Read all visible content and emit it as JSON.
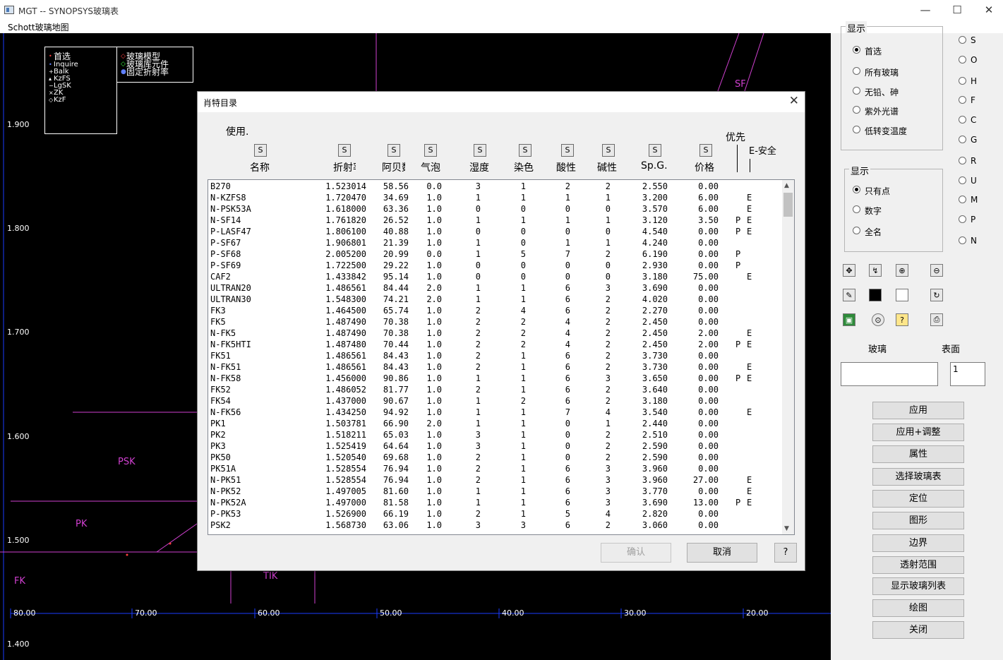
{
  "window": {
    "title": "MGT -- SYNOPSYS玻璃表",
    "minimize": "—",
    "maximize": "☐",
    "close": "✕"
  },
  "menu": {
    "item": "Schott玻璃地图"
  },
  "map": {
    "region_labels": [
      "SF",
      "PSK",
      "PK",
      "FK",
      "TIK"
    ],
    "y_ticks": [
      "1.900",
      "1.800",
      "1.700",
      "1.600",
      "1.500",
      "1.400"
    ],
    "x_ticks": [
      "80.00",
      "70.00",
      "60.00",
      "50.00",
      "40.00",
      "30.00",
      "20.00"
    ],
    "legend": [
      "首选",
      "Inquire",
      "Balk",
      "KzFS",
      "LgSK",
      "ZK",
      "KzF"
    ],
    "legend2": [
      "玻璃模型",
      "玻璃库元件",
      "固定折射率"
    ]
  },
  "dialog": {
    "title": "肖特目录",
    "close": "✕",
    "use_label": "使用.",
    "priority_label": "优先",
    "safe_label": "E-安全",
    "sort_btn": "S",
    "columns": [
      "名称",
      "折射率",
      "阿贝数",
      "气泡",
      "湿度",
      "染色",
      "酸性",
      "碱性",
      "Sp.G.",
      "价格"
    ],
    "rows": [
      [
        "B270",
        "1.523014",
        "58.56",
        "0.0",
        "3",
        "1",
        "2",
        "2",
        "2.550",
        "0.00",
        "",
        ""
      ],
      [
        "N-KZFS8",
        "1.720470",
        "34.69",
        "1.0",
        "1",
        "1",
        "1",
        "1",
        "3.200",
        "6.00",
        "",
        "E"
      ],
      [
        "N-PSK53A",
        "1.618000",
        "63.36",
        "1.0",
        "0",
        "0",
        "0",
        "0",
        "3.570",
        "6.00",
        "",
        "E"
      ],
      [
        "N-SF14",
        "1.761820",
        "26.52",
        "1.0",
        "1",
        "1",
        "1",
        "1",
        "3.120",
        "3.50",
        "P",
        "E"
      ],
      [
        "P-LASF47",
        "1.806100",
        "40.88",
        "1.0",
        "0",
        "0",
        "0",
        "0",
        "4.540",
        "0.00",
        "P",
        "E"
      ],
      [
        "P-SF67",
        "1.906801",
        "21.39",
        "1.0",
        "1",
        "0",
        "1",
        "1",
        "4.240",
        "0.00",
        "",
        ""
      ],
      [
        "P-SF68",
        "2.005200",
        "20.99",
        "0.0",
        "1",
        "5",
        "7",
        "2",
        "6.190",
        "0.00",
        "P",
        ""
      ],
      [
        "P-SF69",
        "1.722500",
        "29.22",
        "1.0",
        "0",
        "0",
        "0",
        "0",
        "2.930",
        "0.00",
        "P",
        ""
      ],
      [
        "CAF2",
        "1.433842",
        "95.14",
        "1.0",
        "0",
        "0",
        "0",
        "0",
        "3.180",
        "75.00",
        "",
        "E"
      ],
      [
        "ULTRAN20",
        "1.486561",
        "84.44",
        "2.0",
        "1",
        "1",
        "6",
        "3",
        "3.690",
        "0.00",
        "",
        ""
      ],
      [
        "ULTRAN30",
        "1.548300",
        "74.21",
        "2.0",
        "1",
        "1",
        "6",
        "2",
        "4.020",
        "0.00",
        "",
        ""
      ],
      [
        "FK3",
        "1.464500",
        "65.74",
        "1.0",
        "2",
        "4",
        "6",
        "2",
        "2.270",
        "0.00",
        "",
        ""
      ],
      [
        "FK5",
        "1.487490",
        "70.38",
        "1.0",
        "2",
        "2",
        "4",
        "2",
        "2.450",
        "0.00",
        "",
        ""
      ],
      [
        "N-FK5",
        "1.487490",
        "70.38",
        "1.0",
        "2",
        "2",
        "4",
        "2",
        "2.450",
        "2.00",
        "",
        "E"
      ],
      [
        "N-FK5HTI",
        "1.487480",
        "70.44",
        "1.0",
        "2",
        "2",
        "4",
        "2",
        "2.450",
        "2.00",
        "P",
        "E"
      ],
      [
        "FK51",
        "1.486561",
        "84.43",
        "1.0",
        "2",
        "1",
        "6",
        "2",
        "3.730",
        "0.00",
        "",
        ""
      ],
      [
        "N-FK51",
        "1.486561",
        "84.43",
        "1.0",
        "2",
        "1",
        "6",
        "2",
        "3.730",
        "0.00",
        "",
        "E"
      ],
      [
        "N-FK58",
        "1.456000",
        "90.86",
        "1.0",
        "1",
        "1",
        "6",
        "3",
        "3.650",
        "0.00",
        "P",
        "E"
      ],
      [
        "FK52",
        "1.486052",
        "81.77",
        "1.0",
        "2",
        "1",
        "6",
        "2",
        "3.640",
        "0.00",
        "",
        ""
      ],
      [
        "FK54",
        "1.437000",
        "90.67",
        "1.0",
        "1",
        "2",
        "6",
        "2",
        "3.180",
        "0.00",
        "",
        ""
      ],
      [
        "N-FK56",
        "1.434250",
        "94.92",
        "1.0",
        "1",
        "1",
        "7",
        "4",
        "3.540",
        "0.00",
        "",
        "E"
      ],
      [
        "PK1",
        "1.503781",
        "66.90",
        "2.0",
        "1",
        "1",
        "0",
        "1",
        "2.440",
        "0.00",
        "",
        ""
      ],
      [
        "PK2",
        "1.518211",
        "65.03",
        "1.0",
        "3",
        "1",
        "0",
        "2",
        "2.510",
        "0.00",
        "",
        ""
      ],
      [
        "PK3",
        "1.525419",
        "64.64",
        "1.0",
        "3",
        "1",
        "0",
        "2",
        "2.590",
        "0.00",
        "",
        ""
      ],
      [
        "PK50",
        "1.520540",
        "69.68",
        "1.0",
        "2",
        "1",
        "0",
        "2",
        "2.590",
        "0.00",
        "",
        ""
      ],
      [
        "PK51A",
        "1.528554",
        "76.94",
        "1.0",
        "2",
        "1",
        "6",
        "3",
        "3.960",
        "0.00",
        "",
        ""
      ],
      [
        "N-PK51",
        "1.528554",
        "76.94",
        "1.0",
        "2",
        "1",
        "6",
        "3",
        "3.960",
        "27.00",
        "",
        "E"
      ],
      [
        "N-PK52",
        "1.497005",
        "81.60",
        "1.0",
        "1",
        "1",
        "6",
        "3",
        "3.770",
        "0.00",
        "",
        "E"
      ],
      [
        "N-PK52A",
        "1.497000",
        "81.58",
        "1.0",
        "1",
        "1",
        "6",
        "3",
        "3.690",
        "13.00",
        "P",
        "E"
      ],
      [
        "P-PK53",
        "1.526900",
        "66.19",
        "1.0",
        "2",
        "1",
        "5",
        "4",
        "2.820",
        "0.00",
        "",
        ""
      ],
      [
        "PSK2",
        "1.568730",
        "63.06",
        "1.0",
        "3",
        "3",
        "6",
        "2",
        "3.060",
        "0.00",
        "",
        ""
      ]
    ],
    "ok_button": "确认",
    "cancel_button": "取消",
    "help_button": "?"
  },
  "right_panel": {
    "display_group1": {
      "title": "显示",
      "options": [
        "首选",
        "所有玻璃",
        "无铅、砷",
        "紫外光谱",
        "低转变温度"
      ],
      "selected": 0
    },
    "display_group2": {
      "title": "显示",
      "options": [
        "只有点",
        "数字",
        "全名"
      ],
      "selected": 0
    },
    "letters": [
      "S",
      "O",
      "H",
      "F",
      "C",
      "G",
      "R",
      "U",
      "M",
      "P",
      "N"
    ],
    "glass_label": "玻璃",
    "surface_label": "表面",
    "glass_value": "",
    "surface_value": "1",
    "buttons": [
      "应用",
      "应用+调整",
      "属性",
      "选择玻璃表",
      "定位",
      "图形",
      "边界",
      "透射范围",
      "显示玻璃列表",
      "绘图",
      "关闭"
    ]
  }
}
